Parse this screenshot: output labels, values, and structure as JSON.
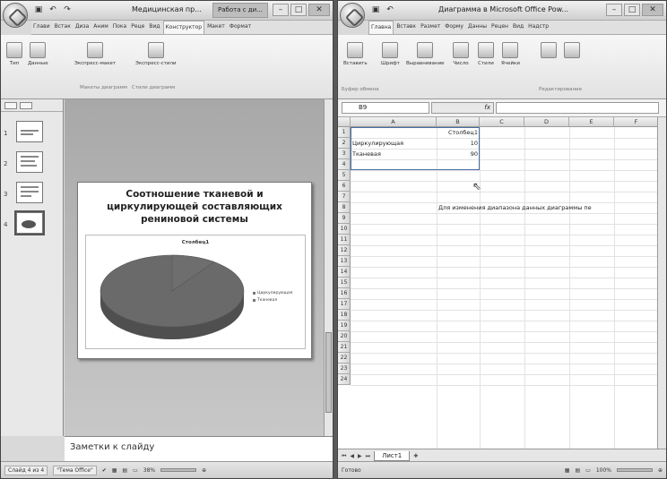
{
  "powerpoint": {
    "title": "Медицинская пр...",
    "context_tab": "Работа с ди...",
    "tabs": [
      "Глави",
      "Встак",
      "Диза",
      "Аним",
      "Пока",
      "Реце",
      "Вид",
      "Конструктор",
      "Макет",
      "Формат"
    ],
    "ribbon": {
      "btn_type": "Тип",
      "btn_data": "Данные",
      "btn_express_layout": "Экспресс-макет",
      "btn_express_styles": "Экспресс-стили",
      "group_layouts": "Макеты диаграмм",
      "group_styles": "Стили диаграмм"
    },
    "slide_numbers": [
      "1",
      "2",
      "3",
      "4"
    ],
    "slide": {
      "title_line1": "Соотношение тканевой и",
      "title_line2": "циркулирующей составляющих",
      "title_line3": "рениновой системы"
    },
    "notes_placeholder": "Заметки к слайду",
    "status": {
      "slide_info": "Слайд 4 из 4",
      "theme": "\"Тема Office\"",
      "zoom": "38%"
    }
  },
  "excel": {
    "title": "Диаграмма в Microsoft Office Pow...",
    "tabs": [
      "Главна",
      "Вставк",
      "Размет",
      "Форму",
      "Данны",
      "Рецен",
      "Вид",
      "Надстр"
    ],
    "ribbon": {
      "paste": "Вставить",
      "font": "Шрифт",
      "align": "Выравнивание",
      "number": "Число",
      "styles": "Стили",
      "cells": "Ячейки",
      "clipboard_group": "Буфер обмена",
      "editing_group": "Редактирование"
    },
    "name_box": "B9",
    "fx_label": "fx",
    "columns": [
      "A",
      "B",
      "C",
      "D",
      "E",
      "F"
    ],
    "rows": [
      "1",
      "2",
      "3",
      "4",
      "5",
      "6",
      "7",
      "8",
      "9",
      "10",
      "11",
      "12",
      "13",
      "14",
      "15",
      "16",
      "17",
      "18",
      "19",
      "20",
      "21",
      "22",
      "23",
      "24"
    ],
    "cells": {
      "B1": "Столбец1",
      "A2": "Циркулирующая",
      "B2": "10",
      "A3": "Тканевая",
      "B3": "90",
      "B8": "Для изменения диапазона данных диаграммы пе"
    },
    "sheet_tab": "Лист1",
    "status": {
      "ready": "Готово",
      "zoom": "100%"
    }
  },
  "chart_data": {
    "type": "pie",
    "title": "Столбец1",
    "categories": [
      "Циркулирующая",
      "Тканевая"
    ],
    "values": [
      10,
      90
    ],
    "legend_position": "right"
  }
}
